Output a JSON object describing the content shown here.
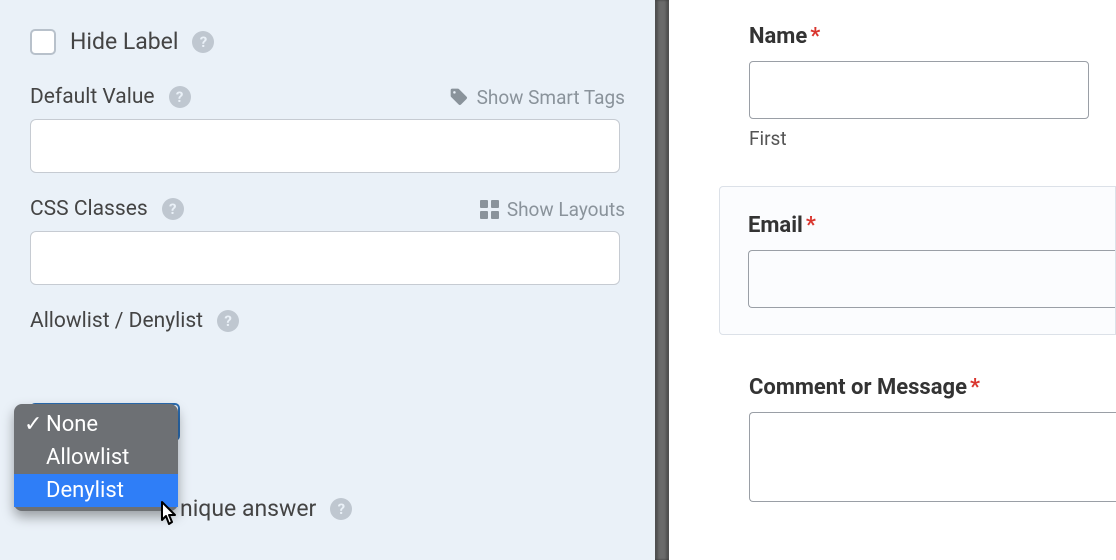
{
  "sidebar": {
    "hide_label_text": "Hide Label",
    "default_value": {
      "label": "Default Value",
      "smart_tags_hint": "Show Smart Tags"
    },
    "css_classes": {
      "label": "CSS Classes",
      "layouts_hint": "Show Layouts"
    },
    "allow_deny": {
      "label": "Allowlist / Denylist",
      "options": [
        {
          "label": "None",
          "selected": true
        },
        {
          "label": "Allowlist",
          "selected": false
        },
        {
          "label": "Denylist",
          "selected": false,
          "highlight": true
        }
      ]
    },
    "unique_answer_fragment": "nique answer"
  },
  "preview": {
    "name": {
      "label": "Name",
      "sublabel": "First"
    },
    "email": {
      "label": "Email"
    },
    "comment": {
      "label": "Comment or Message"
    }
  },
  "icons": {
    "help": "?",
    "check": "✓"
  }
}
